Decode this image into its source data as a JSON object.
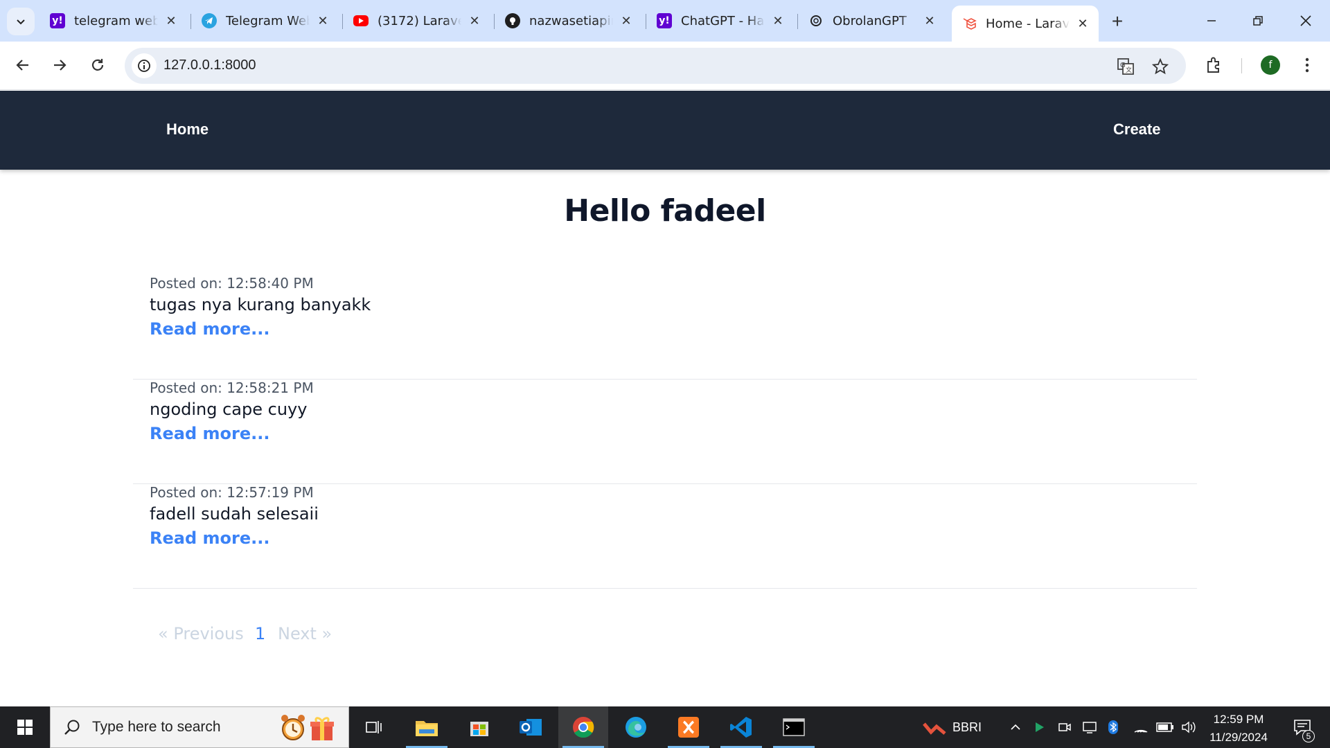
{
  "browser": {
    "tabs": [
      {
        "title": "telegram web",
        "icon": "yahoo-icon"
      },
      {
        "title": "Telegram Web",
        "icon": "telegram-icon"
      },
      {
        "title": "(3172) Laravel",
        "icon": "youtube-icon"
      },
      {
        "title": "nazwasetiapin",
        "icon": "github-icon"
      },
      {
        "title": "ChatGPT - Has",
        "icon": "yahoo-icon"
      },
      {
        "title": "ObrolanGPT",
        "icon": "openai-icon"
      },
      {
        "title": "Home - Larave",
        "icon": "laravel-icon",
        "active": true
      }
    ],
    "address": "127.0.0.1:8000",
    "profile_initial": "f"
  },
  "page": {
    "nav": {
      "home": "Home",
      "create": "Create"
    },
    "heading": "Hello fadeel",
    "posts": [
      {
        "date": "Posted on: 12:58:40 PM",
        "title": "tugas nya kurang banyakk",
        "more": "Read more..."
      },
      {
        "date": "Posted on: 12:58:21 PM",
        "title": "ngoding cape cuyy",
        "more": "Read more..."
      },
      {
        "date": "Posted on: 12:57:19 PM",
        "title": "fadell sudah selesaii",
        "more": "Read more..."
      }
    ],
    "pagination": {
      "previous": "« Previous",
      "current": "1",
      "next": "Next »"
    }
  },
  "taskbar": {
    "search_placeholder": "Type here to search",
    "stock_ticker": "BBRI",
    "time": "12:59 PM",
    "date": "11/29/2024",
    "notification_count": "5"
  },
  "colors": {
    "nav_bg": "#1e293b",
    "link_blue": "#3b82f6",
    "tabstrip_bg": "#d3e3fd"
  }
}
